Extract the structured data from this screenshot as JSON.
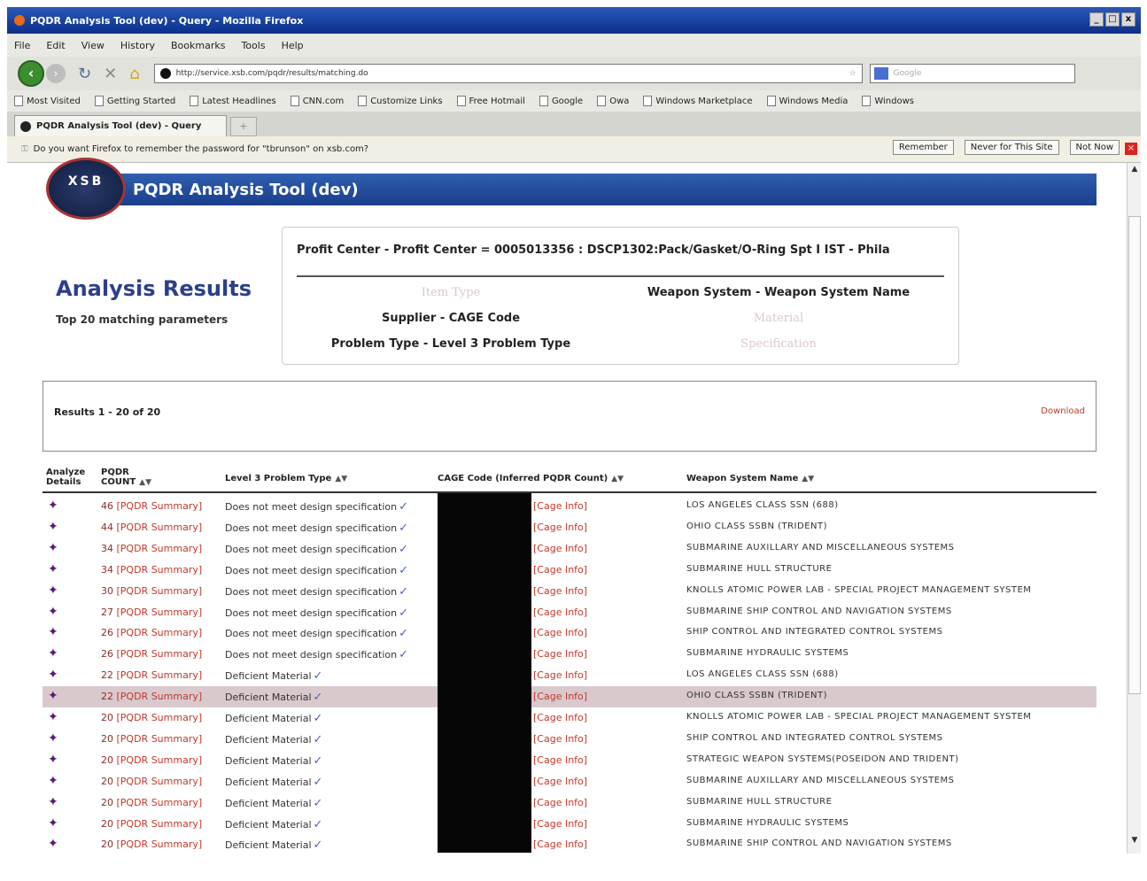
{
  "window": {
    "title": "PQDR Analysis Tool (dev) - Query - Mozilla Firefox",
    "controls": [
      "_",
      "□",
      "x"
    ]
  },
  "menu": [
    "File",
    "Edit",
    "View",
    "History",
    "Bookmarks",
    "Tools",
    "Help"
  ],
  "nav": {
    "url": "http://service.xsb.com/pqdr/results/matching.do",
    "search_placeholder": "Google"
  },
  "bookmarks": [
    "Most Visited",
    "Getting Started",
    "Latest Headlines",
    "CNN.com",
    "Customize Links",
    "Free Hotmail",
    "Google",
    "Owa",
    "Windows Marketplace",
    "Windows Media",
    "Windows"
  ],
  "tab": {
    "title": "PQDR Analysis Tool (dev) - Query"
  },
  "notification": {
    "text": "Do you want Firefox to remember the password for \"tbrunson\" on xsb.com?",
    "remember": "Remember",
    "never": "Never for This Site",
    "not_now": "Not Now"
  },
  "page": {
    "logo": "XSB",
    "app_title": "PQDR Analysis Tool (dev)",
    "analysis_title": "Analysis Results",
    "analysis_sub": "Top 20 matching parameters",
    "profit_center": "Profit Center - Profit Center = 0005013356 : DSCP1302:Pack/Gasket/O-Ring Spt I IST - Phila",
    "params": {
      "item_type": "Item Type",
      "weapon_system": "Weapon System - Weapon System Name",
      "supplier": "Supplier - CAGE Code",
      "material": "Material",
      "problem_type": "Problem Type - Level 3 Problem Type",
      "specification": "Specification"
    },
    "results_count": "Results 1 - 20 of 20",
    "download": "Download"
  },
  "table": {
    "headers": {
      "analyze": "Analyze Details",
      "pqdr_count": "PQDR COUNT",
      "problem_type": "Level 3 Problem Type",
      "cage": "CAGE Code (Inferred PQDR Count)",
      "weapon": "Weapon System Name"
    },
    "summary_link": "[PQDR Summary]",
    "cage_link": "[Cage Info]",
    "rows": [
      {
        "count": "46",
        "ptype": "Does not meet design specification",
        "weapon": "LOS ANGELES CLASS SSN (688)"
      },
      {
        "count": "44",
        "ptype": "Does not meet design specification",
        "weapon": "OHIO CLASS SSBN (TRIDENT)"
      },
      {
        "count": "34",
        "ptype": "Does not meet design specification",
        "weapon": "SUBMARINE AUXILLARY AND MISCELLANEOUS SYSTEMS"
      },
      {
        "count": "34",
        "ptype": "Does not meet design specification",
        "weapon": "SUBMARINE HULL STRUCTURE"
      },
      {
        "count": "30",
        "ptype": "Does not meet design specification",
        "weapon": "KNOLLS ATOMIC POWER LAB - SPECIAL PROJECT MANAGEMENT SYSTEM"
      },
      {
        "count": "27",
        "ptype": "Does not meet design specification",
        "weapon": "SUBMARINE SHIP CONTROL AND NAVIGATION SYSTEMS"
      },
      {
        "count": "26",
        "ptype": "Does not meet design specification",
        "weapon": "SHIP CONTROL AND INTEGRATED CONTROL SYSTEMS"
      },
      {
        "count": "26",
        "ptype": "Does not meet design specification",
        "weapon": "SUBMARINE HYDRAULIC SYSTEMS"
      },
      {
        "count": "22",
        "ptype": "Deficient Material",
        "weapon": "LOS ANGELES CLASS SSN (688)"
      },
      {
        "count": "22",
        "ptype": "Deficient Material",
        "weapon": "OHIO CLASS SSBN (TRIDENT)"
      },
      {
        "count": "20",
        "ptype": "Deficient Material",
        "weapon": "KNOLLS ATOMIC POWER LAB - SPECIAL PROJECT MANAGEMENT SYSTEM"
      },
      {
        "count": "20",
        "ptype": "Deficient Material",
        "weapon": "SHIP CONTROL AND INTEGRATED CONTROL SYSTEMS"
      },
      {
        "count": "20",
        "ptype": "Deficient Material",
        "weapon": "STRATEGIC WEAPON SYSTEMS(POSEIDON AND TRIDENT)"
      },
      {
        "count": "20",
        "ptype": "Deficient Material",
        "weapon": "SUBMARINE AUXILLARY AND MISCELLANEOUS SYSTEMS"
      },
      {
        "count": "20",
        "ptype": "Deficient Material",
        "weapon": "SUBMARINE HULL STRUCTURE"
      },
      {
        "count": "20",
        "ptype": "Deficient Material",
        "weapon": "SUBMARINE HYDRAULIC SYSTEMS"
      },
      {
        "count": "20",
        "ptype": "Deficient Material",
        "weapon": "SUBMARINE SHIP CONTROL AND NAVIGATION SYSTEMS"
      }
    ],
    "selected_row": 9
  }
}
